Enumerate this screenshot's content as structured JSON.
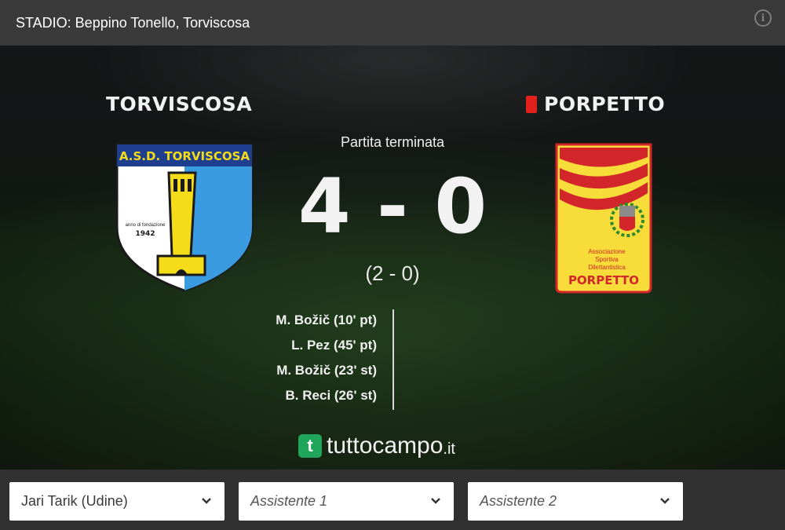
{
  "header": {
    "stadium": "STADIO: Beppino Tonello, Torviscosa",
    "info_icon": "info-circle-icon"
  },
  "match": {
    "home_team": "TORVISCOSA",
    "away_team": "PORPETTO",
    "away_card": "red-card-icon",
    "status": "Partita terminata",
    "score": "4 - 0",
    "halftime": "(2 - 0)",
    "scorers_home": [
      "M. Božič (10' pt)",
      "L. Pez (45' pt)",
      "M. Božič (23' st)",
      "B. Reci (26' st)"
    ]
  },
  "home_logo": {
    "top_text": "A.S.D. TORVISCOSA",
    "founded_text": "anno di fondazione",
    "year": "1942"
  },
  "away_logo": {
    "assoc_line1": "Associazione",
    "assoc_line2": "Sportiva",
    "assoc_line3": "Dilettantistica",
    "name": "PORPETTO"
  },
  "brand": {
    "logo_letter": "t",
    "name": "tuttocampo",
    "tld": ".it"
  },
  "officials": {
    "referee": "Jari Tarik (Udine)",
    "assistant1": "Assistente 1",
    "assistant2": "Assistente 2"
  },
  "colors": {
    "home_primary": "#f5dc18",
    "home_secondary": "#3a9be0",
    "away_primary": "#f7dc3a",
    "away_secondary": "#d3262a",
    "card_red": "#e2211c",
    "brand_green": "#1fa65a"
  }
}
